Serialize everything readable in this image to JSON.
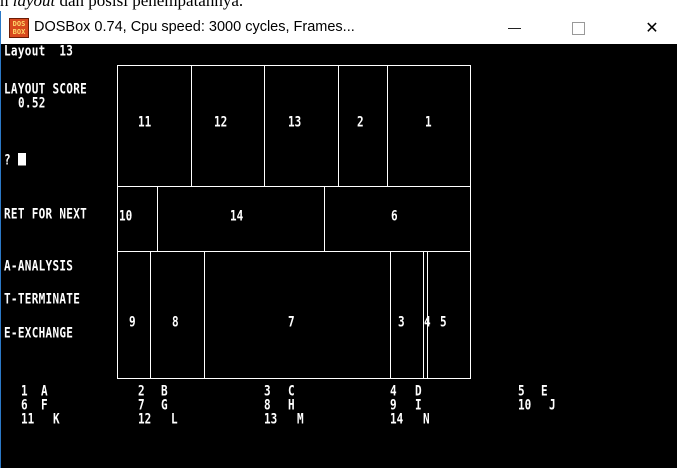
{
  "background_doc": {
    "prefix": "n ",
    "italic": "layout",
    "suffix": " dan posisi penempatannya."
  },
  "window": {
    "icon_text": "DOS\nBOX",
    "title": "DOSBox 0.74, Cpu speed:    3000 cycles, Frames...",
    "minimize_symbol": "—",
    "close_symbol": "✕"
  },
  "console": {
    "layout_label": "Layout  13",
    "score_label": "LAYOUT SCORE",
    "score_value": "0.52",
    "prompt": "?",
    "ret_label": "RET FOR NEXT",
    "menu": [
      "A-ANALYSIS",
      "T-TERMINATE",
      "E-EXCHANGE"
    ]
  },
  "layout_grid": {
    "row1": [
      "11",
      "12",
      "13",
      "2",
      "1"
    ],
    "row2": [
      "10",
      "14",
      "6"
    ],
    "row3": [
      "9",
      "8",
      "7",
      "3",
      "4",
      "5"
    ]
  },
  "legend": [
    {
      "num": "1",
      "letter": "A"
    },
    {
      "num": "2",
      "letter": "B"
    },
    {
      "num": "3",
      "letter": "C"
    },
    {
      "num": "4",
      "letter": "D"
    },
    {
      "num": "5",
      "letter": "E"
    },
    {
      "num": "6",
      "letter": "F"
    },
    {
      "num": "7",
      "letter": "G"
    },
    {
      "num": "8",
      "letter": "H"
    },
    {
      "num": "9",
      "letter": "I"
    },
    {
      "num": "10",
      "letter": "J"
    },
    {
      "num": "11",
      "letter": "K"
    },
    {
      "num": "12",
      "letter": "L"
    },
    {
      "num": "13",
      "letter": "M"
    },
    {
      "num": "14",
      "letter": "N"
    }
  ]
}
